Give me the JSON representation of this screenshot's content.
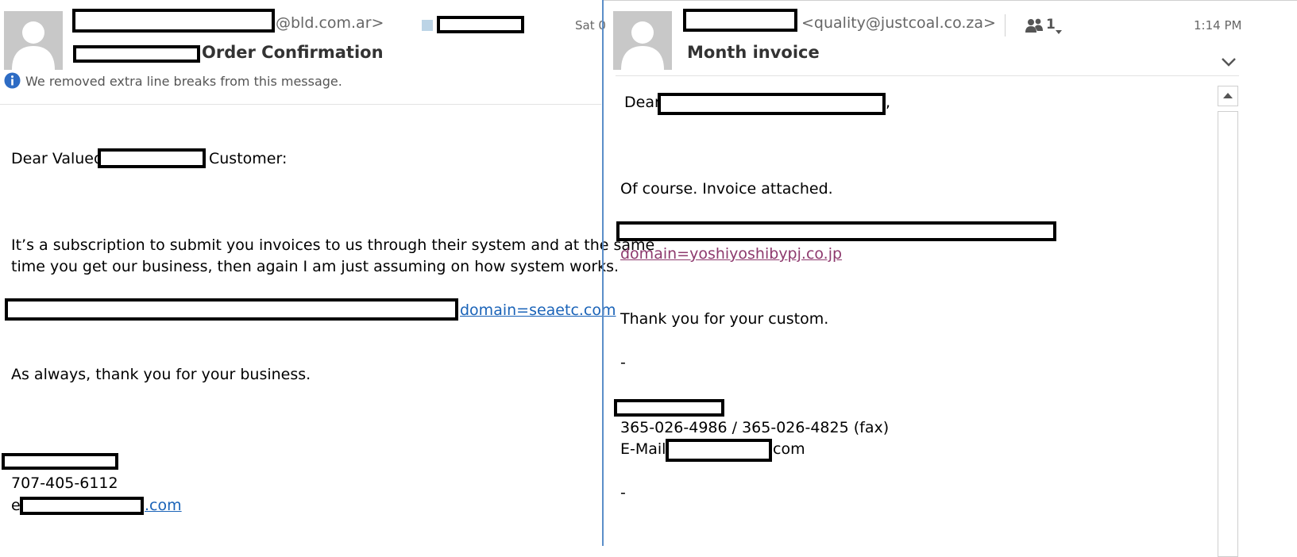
{
  "left_email": {
    "sender_domain": "@bld.com.ar>",
    "date": "Sat 0",
    "subject": "Order Confirmation",
    "notice": "We removed extra line breaks from this message.",
    "greeting_pre": "Dear Valued",
    "greeting_post": "Customer:",
    "paragraph_line1": "It’s a subscription to submit you invoices to us through their system and at the same",
    "paragraph_line2": "time you get our business, then  again I am just assuming on how system works.",
    "link": "domain=seaetc.com",
    "thanks": "As always, thank you for your business.",
    "phone": "707-405-6112",
    "email_prefix": "e",
    "email_suffix": ".com"
  },
  "right_email": {
    "sender_email": "<quality@justcoal.co.za>",
    "participants_count": "1",
    "time": "1:14 PM",
    "subject": "Month invoice",
    "greeting_pre": "Dear",
    "greeting_post": ",",
    "line1": "Of course. Invoice attached.",
    "link": "domain=yoshiyoshibypj.co.jp",
    "thanks": "Thank you for your custom.",
    "dash1": "-",
    "phone": "365-026-4986 / 365-026-4825  (fax)",
    "email_label": "E-Mail:",
    "email_suffix": "com",
    "dash2": "-"
  },
  "icons": {
    "info": "info-icon",
    "people": "people-icon",
    "expand": "chevron-down-icon",
    "scroll_up": "scroll-up-icon"
  },
  "colors": {
    "link": "#1a63b8",
    "visited_link": "#8e3a6e",
    "info_blue": "#2e6cc4",
    "divider": "#5b8ec9"
  }
}
